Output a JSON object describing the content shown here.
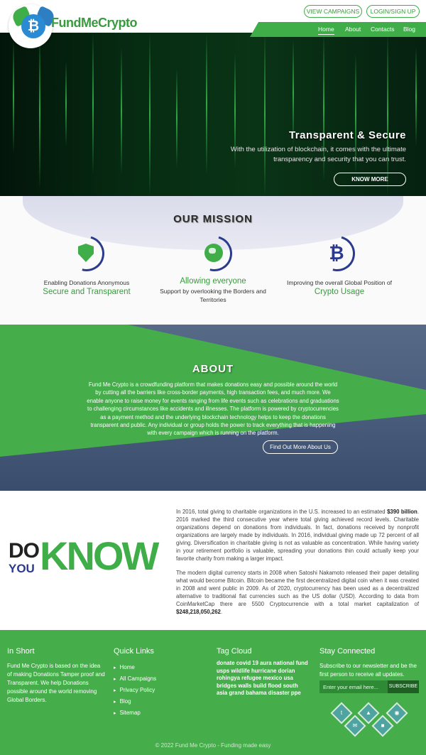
{
  "header": {
    "logo_text": "FundMeCrypto",
    "btn_campaigns": "VIEW CAMPAIGNS",
    "btn_login": "LOGIN/SIGN UP",
    "nav": [
      "Home",
      "About",
      "Contacts",
      "Blog"
    ]
  },
  "hero": {
    "title": "Transparent & Secure",
    "subtitle": "With the utilization of blockchain, it comes with the ultimate transparency and security that you can trust.",
    "button": "KNOW MORE"
  },
  "mission": {
    "title": "OUR MISSION",
    "items": [
      {
        "icon": "shield-icon",
        "small": "Enabling Donations Anonymous",
        "green": "Secure and Transparent"
      },
      {
        "icon": "globe-icon",
        "green": "Allowing everyone",
        "small": "Support by overlooking the Borders and Territories"
      },
      {
        "icon": "bitcoin-icon",
        "small": "Improving the overall Global Position of",
        "green": "Crypto Usage"
      }
    ]
  },
  "about": {
    "title": "ABOUT",
    "text": "Fund Me Crypto is a crowdfunding platform that makes donations easy and possible around the world by cutting all the barriers like cross-border payments, high transaction fees, and much more. We enable anyone to raise money for events ranging from life events such as celebrations and graduations to challenging circumstances like accidents and illnesses. The platform is powered by cryptocurrencies as a payment method and the underlying blockchain technology helps to keep the donations transparent and public. Any individual or group holds the power to track everything that is happening with every campaign which is running on the platform.",
    "button": "Find Out More About Us"
  },
  "know": {
    "do": "DO",
    "you": "YOU",
    "know": "KNOW",
    "p1_a": "In 2016, total giving to charitable organizations in the U.S. increased to an estimated ",
    "p1_b": "$390 billion",
    "p1_c": ". 2016 marked the third consecutive year where total giving achieved record levels. Charitable organizations depend on donations from individuals. In fact, donations received by nonprofit organizations are largely made by individuals. In 2016, individual giving made up 72 percent of all giving. Diversification in charitable giving is not as valuable as concentration. While having variety in your retirement portfolio is valuable, spreading your donations thin could actually keep your favorite charity from making a larger impact.",
    "p2_a": "The modern digital currency starts in 2008 when Satoshi Nakamoto released their paper detailing what would become Bitcoin. Bitcoin became the first decentralized digital coin when it was created in 2008 and went public in 2009. As of 2020, cryptocurrency has been used as a decentralized alternative to traditional fiat currencies such as the US dollar (USD). According to data from CoinMarketCap there are 5500 Cryptocurrencie with a total market capitalization of ",
    "p2_b": "$248,218,050,262",
    "p2_c": "."
  },
  "footer": {
    "in_short_title": "In Short",
    "in_short_text": "Fund Me Crypto is based on the idea of making Donations Tamper proof and Transparent. We help Donations possible around the world removing Global Borders.",
    "quick_links_title": "Quick Links",
    "quick_links": [
      "Home",
      "All Campaigns",
      "Privacy Policy",
      "Blog",
      "Sitemap"
    ],
    "tag_cloud_title": "Tag Cloud",
    "tags": "donate covid 19 aura national fund usps wildlife hurricane dorian rohingya refugee mexico usa bridges walls build flood south asia grand bahama disaster ppe",
    "stay_title": "Stay Connected",
    "stay_text": "Subscribe to our newsletter and be the first person to receive all updates.",
    "email_placeholder": "Enter your email here...",
    "subscribe": "SUBSCRIBE",
    "copyright": "© 2022 Fund Me Crypto - Funding made easy"
  }
}
